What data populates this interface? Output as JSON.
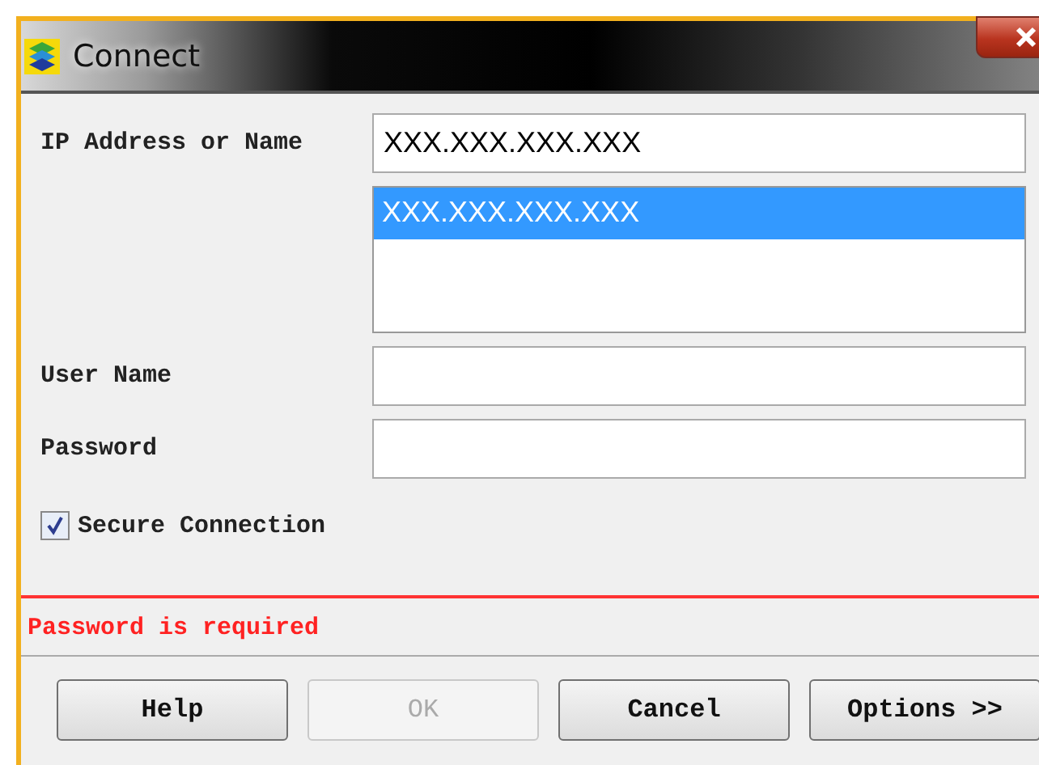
{
  "window": {
    "title": "Connect"
  },
  "ip_field": {
    "label": "IP Address or Name",
    "value": "XXX.XXX.XXX.XXX"
  },
  "history_list": [
    {
      "text": "XXX.XXX.XXX.XXX",
      "selected": true
    }
  ],
  "user_field": {
    "label": "User Name"
  },
  "password_field": {
    "label": "Password"
  },
  "secure_connection": {
    "label": "Secure Connection",
    "checked": true
  },
  "error": "Password is required",
  "buttons": [
    {
      "label": "Help",
      "disabled": false
    },
    {
      "label": "OK",
      "disabled": true
    },
    {
      "label": "Cancel",
      "disabled": false
    },
    {
      "label": "Options >>",
      "disabled": false
    }
  ]
}
